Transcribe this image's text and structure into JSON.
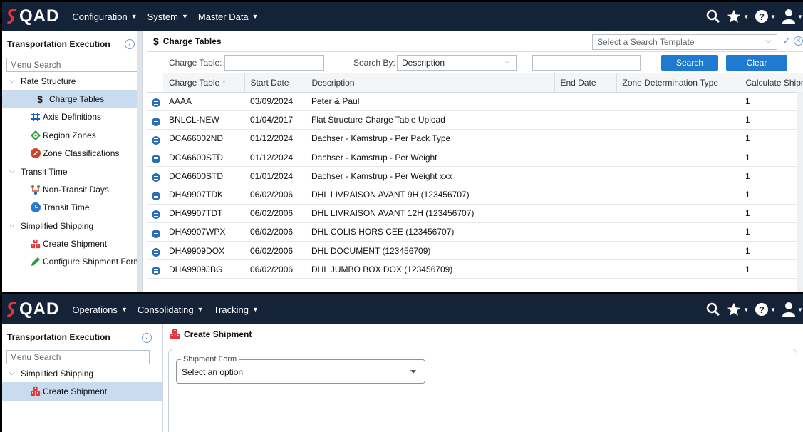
{
  "colors": {
    "topbar": "#152338",
    "accent": "#1f7ad0",
    "active_row": "#c9dbee",
    "brand_red": "#e2363b"
  },
  "screen1": {
    "brand": "QAD",
    "menus": [
      {
        "label": "Configuration"
      },
      {
        "label": "System"
      },
      {
        "label": "Master Data"
      }
    ],
    "sidebar": {
      "title": "Transportation Execution",
      "search_placeholder": "Menu Search",
      "groups": [
        {
          "label": "Rate Structure"
        },
        {
          "label": "Transit Time"
        },
        {
          "label": "Simplified Shipping"
        }
      ],
      "items": [
        {
          "label": "Charge Tables",
          "icon": "dollar-icon"
        },
        {
          "label": "Axis Definitions",
          "icon": "axis-icon"
        },
        {
          "label": "Region Zones",
          "icon": "region-icon"
        },
        {
          "label": "Zone Classifications",
          "icon": "zone-icon"
        },
        {
          "label": "Non-Transit Days",
          "icon": "non-transit-icon"
        },
        {
          "label": "Transit Time",
          "icon": "clock-icon"
        },
        {
          "label": "Create Shipment",
          "icon": "boxes-icon"
        },
        {
          "label": "Configure Shipment Form",
          "icon": "pencil-icon"
        }
      ]
    },
    "page_title": "Charge Tables",
    "template_placeholder": "Select a Search Template",
    "search": {
      "charge_table_label": "Charge Table:",
      "charge_table_value": "",
      "search_by_label": "Search By:",
      "search_by_value": "Description",
      "search_text": "",
      "search_button": "Search",
      "clear_button": "Clear"
    },
    "table": {
      "columns": [
        "Charge Table",
        "Start Date",
        "Description",
        "End Date",
        "Zone Determination Type",
        "Calculate Shipm"
      ],
      "rows": [
        {
          "code": "AAAA",
          "start": "03/09/2024",
          "desc": "Peter & Paul",
          "end": "",
          "zone": "",
          "calc": "1"
        },
        {
          "code": "BNLCL-NEW",
          "start": "01/04/2017",
          "desc": "Flat Structure Charge Table Upload",
          "end": "",
          "zone": "",
          "calc": "1"
        },
        {
          "code": "DCA66002ND",
          "start": "01/12/2024",
          "desc": "Dachser - Kamstrup - Per Pack Type",
          "end": "",
          "zone": "",
          "calc": "1"
        },
        {
          "code": "DCA6600STD",
          "start": "01/12/2024",
          "desc": "Dachser - Kamstrup - Per Weight",
          "end": "",
          "zone": "",
          "calc": "1"
        },
        {
          "code": "DCA6600STD",
          "start": "01/01/2024",
          "desc": "Dachser - Kamstrup - Per Weight xxx",
          "end": "",
          "zone": "",
          "calc": "1"
        },
        {
          "code": "DHA9907TDK",
          "start": "06/02/2006",
          "desc": "DHL LIVRAISON AVANT 9H (123456707)",
          "end": "",
          "zone": "",
          "calc": "1"
        },
        {
          "code": "DHA9907TDT",
          "start": "06/02/2006",
          "desc": "DHL LIVRAISON AVANT 12H (123456707)",
          "end": "",
          "zone": "",
          "calc": "1"
        },
        {
          "code": "DHA9907WPX",
          "start": "06/02/2006",
          "desc": "DHL COLIS HORS CEE (123456707)",
          "end": "",
          "zone": "",
          "calc": "1"
        },
        {
          "code": "DHA9909DOX",
          "start": "06/02/2006",
          "desc": "DHL DOCUMENT (123456709)",
          "end": "",
          "zone": "",
          "calc": "1"
        },
        {
          "code": "DHA9909JBG",
          "start": "06/02/2006",
          "desc": "DHL JUMBO BOX DOX (123456709)",
          "end": "",
          "zone": "",
          "calc": "1"
        }
      ]
    }
  },
  "screen2": {
    "brand": "QAD",
    "menus": [
      {
        "label": "Operations"
      },
      {
        "label": "Consolidating"
      },
      {
        "label": "Tracking"
      }
    ],
    "sidebar": {
      "title": "Transportation Execution",
      "search_placeholder": "Menu Search",
      "group": "Simplified Shipping",
      "item": "Create Shipment"
    },
    "page_title": "Create Shipment",
    "form": {
      "field_label": "Shipment Form",
      "field_value": "Select an option"
    }
  }
}
